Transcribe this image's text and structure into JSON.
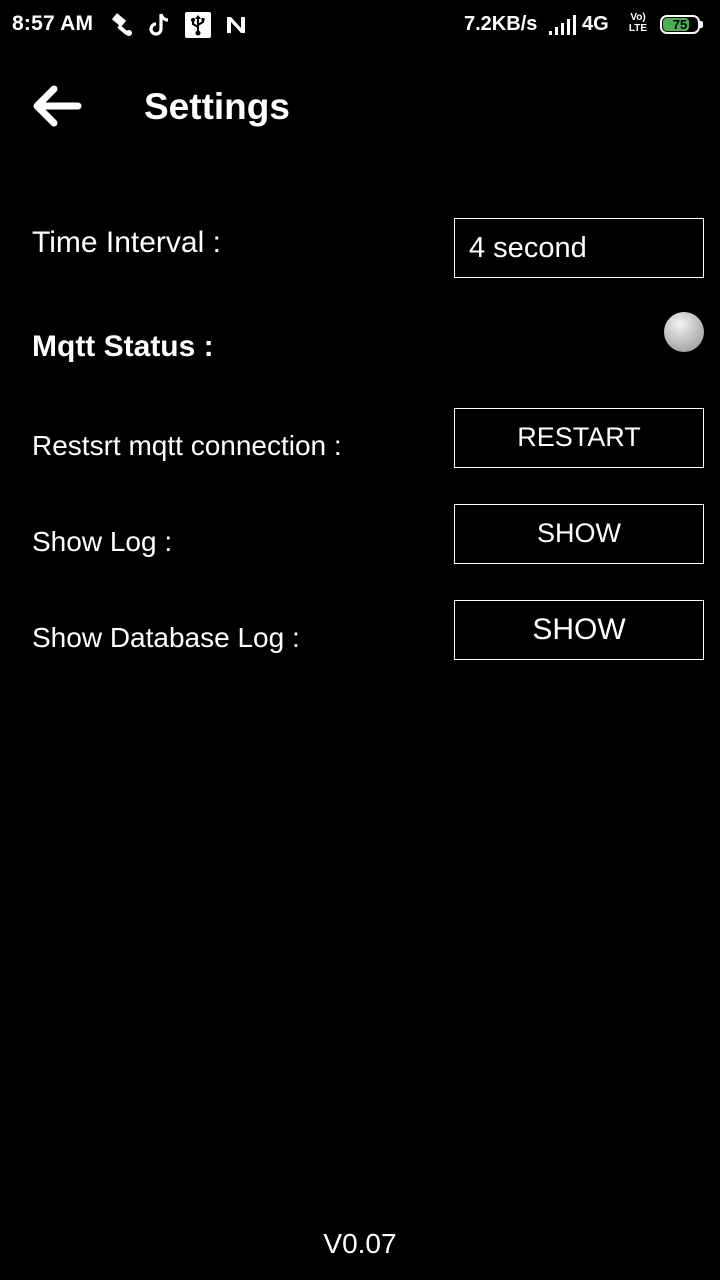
{
  "status_bar": {
    "time": "8:57 AM",
    "left_icons": [
      "hammer-icon",
      "tiktok-icon",
      "usb-icon",
      "n-icon"
    ],
    "network_speed": "7.2KB/s",
    "network_type": "4G",
    "volte_top": "Vo)",
    "volte_bottom": "LTE",
    "battery_level": "75",
    "battery_color": "#4caf50"
  },
  "app_bar": {
    "back_icon": "arrow-left-icon",
    "title": "Settings"
  },
  "settings": {
    "time_interval": {
      "label": "Time Interval :",
      "value": "4 second"
    },
    "mqtt_status": {
      "label": "Mqtt Status :",
      "state_color": "#b0b0b0"
    },
    "restart_mqtt": {
      "label": "Restsrt mqtt connection :",
      "button_label": "RESTART"
    },
    "show_log": {
      "label": "Show Log :",
      "button_label": "SHOW"
    },
    "show_db_log": {
      "label": "Show Database Log :",
      "button_label": "SHOW"
    }
  },
  "version": "V0.07"
}
